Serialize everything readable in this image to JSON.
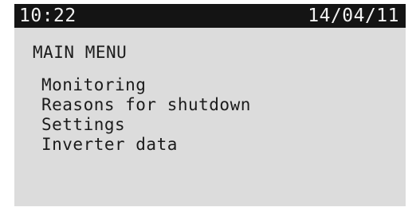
{
  "status": {
    "time": "10:22",
    "date": "14/04/11"
  },
  "menu": {
    "title": "MAIN MENU",
    "items": [
      {
        "label": "Monitoring"
      },
      {
        "label": "Reasons for shutdown"
      },
      {
        "label": "Settings"
      },
      {
        "label": "Inverter data"
      }
    ]
  },
  "colors": {
    "screen_background": "#dcdcdc",
    "status_bar_background": "#141414",
    "status_bar_text": "#f2f2f2",
    "text": "#1b1b1b"
  }
}
